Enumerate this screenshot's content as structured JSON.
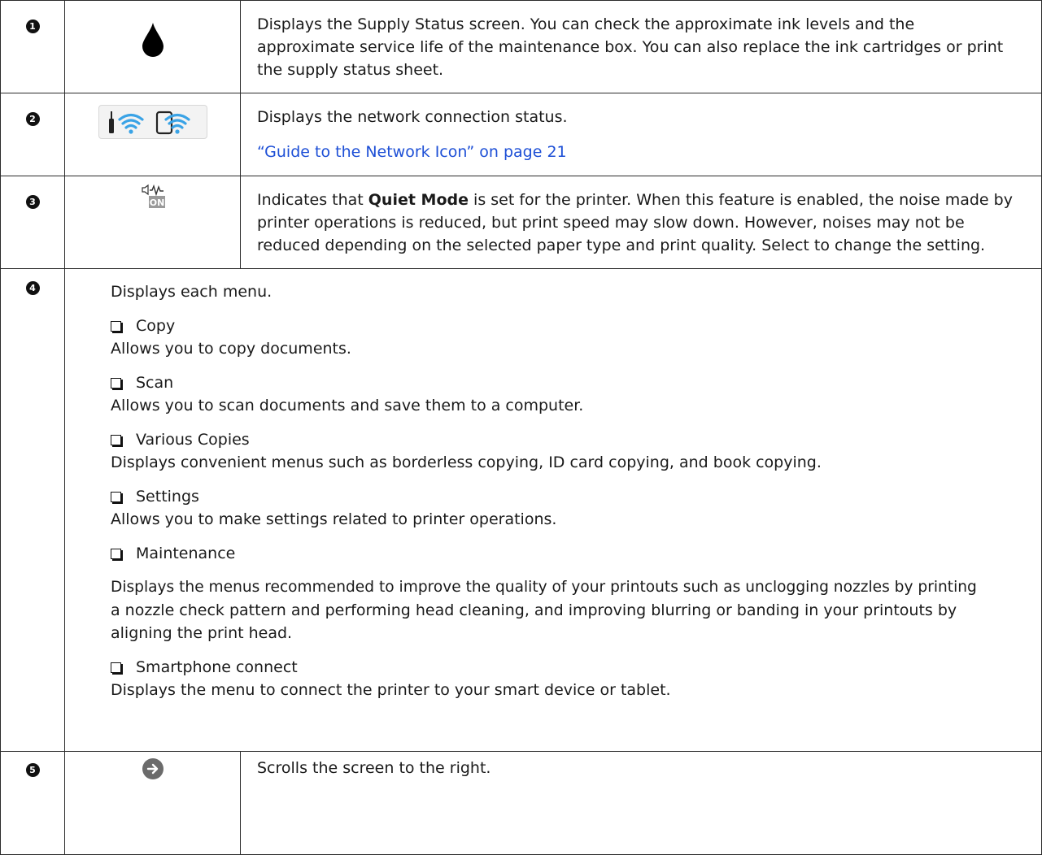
{
  "rows": [
    {
      "num": "1",
      "icon": "ink-drop-icon",
      "lines": [
        "Displays the Supply Status screen. You can check the approximate ink levels and the",
        "approximate service life of the maintenance box. You can also replace the ink cartridges or print",
        "the supply status sheet."
      ]
    },
    {
      "num": "2",
      "icon": "network-status-icon",
      "text": "Displays the network connection status.",
      "link": "“Guide to the Network Icon” on page 21"
    },
    {
      "num": "3",
      "icon": "quiet-mode-icon",
      "quiet_icon_label": "ON",
      "line1_pre": "Indicates that ",
      "line1_bold": "Quiet Mode",
      "line1_post": " is set for the printer. When this feature is enabled, the noise made by",
      "line2": "printer operations is reduced, but print speed may slow down. However, noises may not be",
      "line3": "reduced depending on the selected paper type and print quality. Select to change the setting."
    },
    {
      "num": "4",
      "intro": "Displays each menu.",
      "items": [
        {
          "title": "Copy",
          "desc": [
            "Allows you to copy documents."
          ]
        },
        {
          "title": "Scan",
          "desc": [
            "Allows you to scan documents and save them to a computer."
          ]
        },
        {
          "title": "Various Copies",
          "desc": [
            "Displays convenient menus such as borderless copying, ID card copying, and book copying."
          ]
        },
        {
          "title": "Settings",
          "desc": [
            "Allows you to make settings related to printer operations."
          ]
        },
        {
          "title": "Maintenance",
          "desc": [
            "Displays the menus recommended to improve the quality of your printouts such as unclogging nozzles by printing",
            "a nozzle check pattern and performing head cleaning, and improving blurring or banding in your printouts by",
            "aligning the print head."
          ]
        },
        {
          "title": "Smartphone connect",
          "desc": [
            "Displays the menu to connect the printer to your smart device or tablet."
          ]
        }
      ]
    },
    {
      "num": "5",
      "icon": "arrow-right-icon",
      "text": "Scrolls the screen to the right."
    }
  ],
  "colors": {
    "link": "#1d4fd6",
    "wifi": "#3aa3e6",
    "border": "#2b2b2b",
    "arrow_button": "#6b6b6b"
  }
}
